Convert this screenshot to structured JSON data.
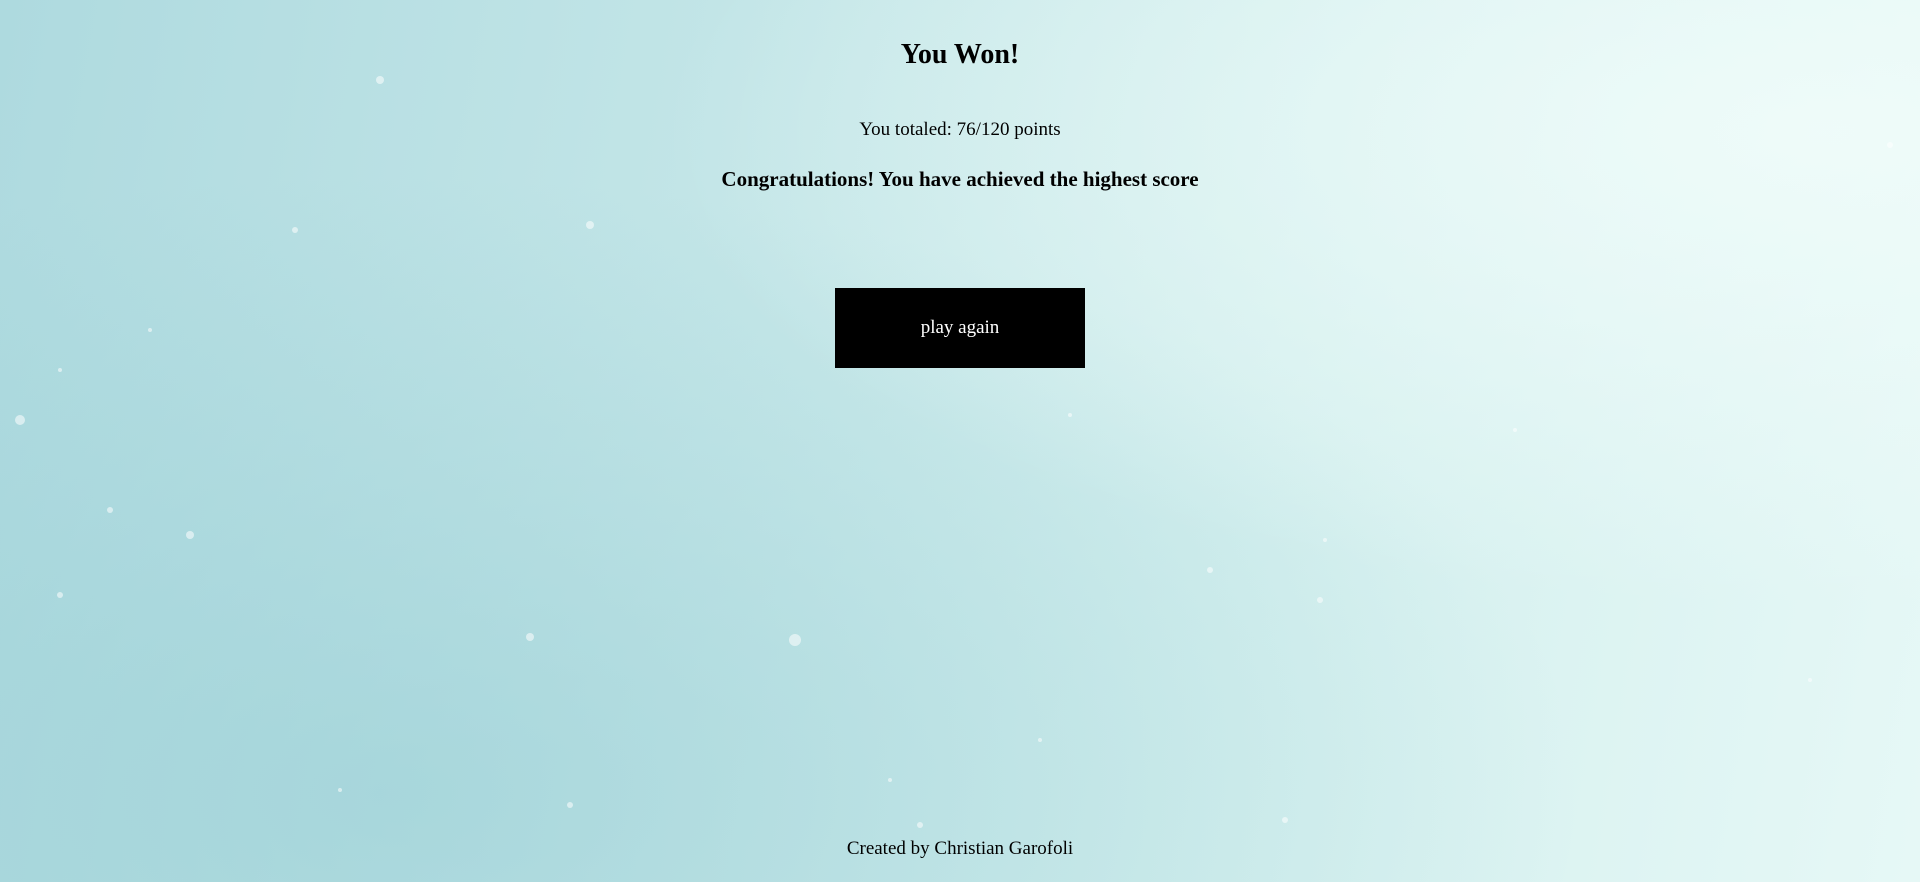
{
  "result": {
    "title": "You Won!",
    "score_text": "You totaled: 76/120 points",
    "message": "Congratulations! You have achieved the highest score",
    "play_again_label": "play again"
  },
  "footer": {
    "credit": "Created by Christian Garofoli"
  },
  "colors": {
    "button_background": "#000000",
    "button_text": "#ffffff",
    "background_tint": "#c2e5e7"
  }
}
